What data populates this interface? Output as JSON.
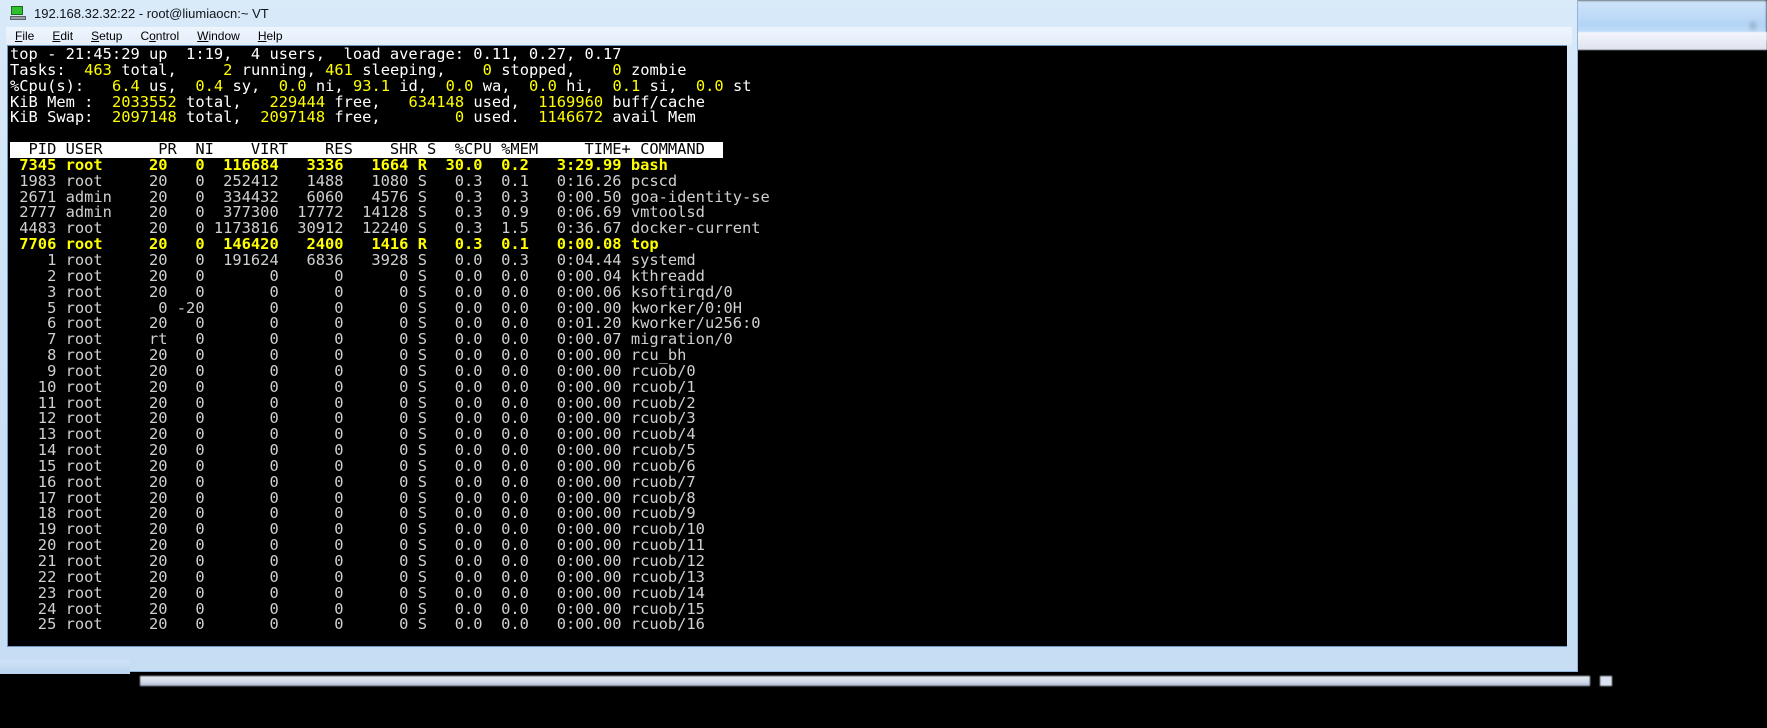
{
  "window": {
    "title": "192.168.32.32:22 - root@liumiaocn:~ VT",
    "icon": "terminal-icon",
    "menu": [
      "File",
      "Edit",
      "Setup",
      "Control",
      "Window",
      "Help"
    ]
  },
  "terminal": {
    "summary": {
      "line1": "top - 21:45:29 up  1:19,  4 users,  load average: 0.11, 0.27, 0.17",
      "tasks_label": "Tasks:",
      "tasks": {
        "total": "463",
        "total_label": "total,",
        "running": "2",
        "running_label": "running,",
        "sleeping": "461",
        "sleeping_label": "sleeping,",
        "stopped": "0",
        "stopped_label": "stopped,",
        "zombie": "0",
        "zombie_label": "zombie"
      },
      "cpu_label": "%Cpu(s):",
      "cpu": {
        "us": "6.4",
        "us_label": "us,",
        "sy": "0.4",
        "sy_label": "sy,",
        "ni": "0.0",
        "ni_label": "ni,",
        "id": "93.1",
        "id_label": "id,",
        "wa": "0.0",
        "wa_label": "wa,",
        "hi": "0.0",
        "hi_label": "hi,",
        "si": "0.1",
        "si_label": "si,",
        "st": "0.0",
        "st_label": "st"
      },
      "mem_label": "KiB Mem :",
      "mem": {
        "total": "2033552",
        "total_label": "total,",
        "free": "229444",
        "free_label": "free,",
        "used": "634148",
        "used_label": "used,",
        "buff": "1169960",
        "buff_label": "buff/cache"
      },
      "swap_label": "KiB Swap:",
      "swap": {
        "total": "2097148",
        "total_label": "total,",
        "free": "2097148",
        "free_label": "free,",
        "used": "0",
        "used_label": "used.",
        "avail": "1146672",
        "avail_label": "avail Mem"
      }
    },
    "columns_line": "  PID USER      PR  NI    VIRT    RES    SHR S  %CPU %MEM     TIME+ COMMAND",
    "columns": [
      "PID",
      "USER",
      "PR",
      "NI",
      "VIRT",
      "RES",
      "SHR",
      "S",
      "%CPU",
      "%MEM",
      "TIME+",
      "COMMAND"
    ],
    "rows": [
      {
        "pid": "7345",
        "user": "root",
        "pr": "20",
        "ni": "0",
        "virt": "116684",
        "res": "3336",
        "shr": "1664",
        "s": "R",
        "cpu": "30.0",
        "mem": "0.2",
        "time": "3:29.99",
        "command": "bash",
        "highlight": true
      },
      {
        "pid": "1983",
        "user": "root",
        "pr": "20",
        "ni": "0",
        "virt": "252412",
        "res": "1488",
        "shr": "1080",
        "s": "S",
        "cpu": "0.3",
        "mem": "0.1",
        "time": "0:16.26",
        "command": "pcscd",
        "highlight": false
      },
      {
        "pid": "2671",
        "user": "admin",
        "pr": "20",
        "ni": "0",
        "virt": "334432",
        "res": "6060",
        "shr": "4576",
        "s": "S",
        "cpu": "0.3",
        "mem": "0.3",
        "time": "0:00.50",
        "command": "goa-identity-se",
        "highlight": false
      },
      {
        "pid": "2777",
        "user": "admin",
        "pr": "20",
        "ni": "0",
        "virt": "377300",
        "res": "17772",
        "shr": "14128",
        "s": "S",
        "cpu": "0.3",
        "mem": "0.9",
        "time": "0:06.69",
        "command": "vmtoolsd",
        "highlight": false
      },
      {
        "pid": "4483",
        "user": "root",
        "pr": "20",
        "ni": "0",
        "virt": "1173816",
        "res": "30912",
        "shr": "12240",
        "s": "S",
        "cpu": "0.3",
        "mem": "1.5",
        "time": "0:36.67",
        "command": "docker-current",
        "highlight": false
      },
      {
        "pid": "7706",
        "user": "root",
        "pr": "20",
        "ni": "0",
        "virt": "146420",
        "res": "2400",
        "shr": "1416",
        "s": "R",
        "cpu": "0.3",
        "mem": "0.1",
        "time": "0:00.08",
        "command": "top",
        "highlight": true
      },
      {
        "pid": "1",
        "user": "root",
        "pr": "20",
        "ni": "0",
        "virt": "191624",
        "res": "6836",
        "shr": "3928",
        "s": "S",
        "cpu": "0.0",
        "mem": "0.3",
        "time": "0:04.44",
        "command": "systemd",
        "highlight": false
      },
      {
        "pid": "2",
        "user": "root",
        "pr": "20",
        "ni": "0",
        "virt": "0",
        "res": "0",
        "shr": "0",
        "s": "S",
        "cpu": "0.0",
        "mem": "0.0",
        "time": "0:00.04",
        "command": "kthreadd",
        "highlight": false
      },
      {
        "pid": "3",
        "user": "root",
        "pr": "20",
        "ni": "0",
        "virt": "0",
        "res": "0",
        "shr": "0",
        "s": "S",
        "cpu": "0.0",
        "mem": "0.0",
        "time": "0:00.06",
        "command": "ksoftirqd/0",
        "highlight": false
      },
      {
        "pid": "5",
        "user": "root",
        "pr": "0",
        "ni": "-20",
        "virt": "0",
        "res": "0",
        "shr": "0",
        "s": "S",
        "cpu": "0.0",
        "mem": "0.0",
        "time": "0:00.00",
        "command": "kworker/0:0H",
        "highlight": false
      },
      {
        "pid": "6",
        "user": "root",
        "pr": "20",
        "ni": "0",
        "virt": "0",
        "res": "0",
        "shr": "0",
        "s": "S",
        "cpu": "0.0",
        "mem": "0.0",
        "time": "0:01.20",
        "command": "kworker/u256:0",
        "highlight": false
      },
      {
        "pid": "7",
        "user": "root",
        "pr": "rt",
        "ni": "0",
        "virt": "0",
        "res": "0",
        "shr": "0",
        "s": "S",
        "cpu": "0.0",
        "mem": "0.0",
        "time": "0:00.07",
        "command": "migration/0",
        "highlight": false
      },
      {
        "pid": "8",
        "user": "root",
        "pr": "20",
        "ni": "0",
        "virt": "0",
        "res": "0",
        "shr": "0",
        "s": "S",
        "cpu": "0.0",
        "mem": "0.0",
        "time": "0:00.00",
        "command": "rcu_bh",
        "highlight": false
      },
      {
        "pid": "9",
        "user": "root",
        "pr": "20",
        "ni": "0",
        "virt": "0",
        "res": "0",
        "shr": "0",
        "s": "S",
        "cpu": "0.0",
        "mem": "0.0",
        "time": "0:00.00",
        "command": "rcuob/0",
        "highlight": false
      },
      {
        "pid": "10",
        "user": "root",
        "pr": "20",
        "ni": "0",
        "virt": "0",
        "res": "0",
        "shr": "0",
        "s": "S",
        "cpu": "0.0",
        "mem": "0.0",
        "time": "0:00.00",
        "command": "rcuob/1",
        "highlight": false
      },
      {
        "pid": "11",
        "user": "root",
        "pr": "20",
        "ni": "0",
        "virt": "0",
        "res": "0",
        "shr": "0",
        "s": "S",
        "cpu": "0.0",
        "mem": "0.0",
        "time": "0:00.00",
        "command": "rcuob/2",
        "highlight": false
      },
      {
        "pid": "12",
        "user": "root",
        "pr": "20",
        "ni": "0",
        "virt": "0",
        "res": "0",
        "shr": "0",
        "s": "S",
        "cpu": "0.0",
        "mem": "0.0",
        "time": "0:00.00",
        "command": "rcuob/3",
        "highlight": false
      },
      {
        "pid": "13",
        "user": "root",
        "pr": "20",
        "ni": "0",
        "virt": "0",
        "res": "0",
        "shr": "0",
        "s": "S",
        "cpu": "0.0",
        "mem": "0.0",
        "time": "0:00.00",
        "command": "rcuob/4",
        "highlight": false
      },
      {
        "pid": "14",
        "user": "root",
        "pr": "20",
        "ni": "0",
        "virt": "0",
        "res": "0",
        "shr": "0",
        "s": "S",
        "cpu": "0.0",
        "mem": "0.0",
        "time": "0:00.00",
        "command": "rcuob/5",
        "highlight": false
      },
      {
        "pid": "15",
        "user": "root",
        "pr": "20",
        "ni": "0",
        "virt": "0",
        "res": "0",
        "shr": "0",
        "s": "S",
        "cpu": "0.0",
        "mem": "0.0",
        "time": "0:00.00",
        "command": "rcuob/6",
        "highlight": false
      },
      {
        "pid": "16",
        "user": "root",
        "pr": "20",
        "ni": "0",
        "virt": "0",
        "res": "0",
        "shr": "0",
        "s": "S",
        "cpu": "0.0",
        "mem": "0.0",
        "time": "0:00.00",
        "command": "rcuob/7",
        "highlight": false
      },
      {
        "pid": "17",
        "user": "root",
        "pr": "20",
        "ni": "0",
        "virt": "0",
        "res": "0",
        "shr": "0",
        "s": "S",
        "cpu": "0.0",
        "mem": "0.0",
        "time": "0:00.00",
        "command": "rcuob/8",
        "highlight": false
      },
      {
        "pid": "18",
        "user": "root",
        "pr": "20",
        "ni": "0",
        "virt": "0",
        "res": "0",
        "shr": "0",
        "s": "S",
        "cpu": "0.0",
        "mem": "0.0",
        "time": "0:00.00",
        "command": "rcuob/9",
        "highlight": false
      },
      {
        "pid": "19",
        "user": "root",
        "pr": "20",
        "ni": "0",
        "virt": "0",
        "res": "0",
        "shr": "0",
        "s": "S",
        "cpu": "0.0",
        "mem": "0.0",
        "time": "0:00.00",
        "command": "rcuob/10",
        "highlight": false
      },
      {
        "pid": "20",
        "user": "root",
        "pr": "20",
        "ni": "0",
        "virt": "0",
        "res": "0",
        "shr": "0",
        "s": "S",
        "cpu": "0.0",
        "mem": "0.0",
        "time": "0:00.00",
        "command": "rcuob/11",
        "highlight": false
      },
      {
        "pid": "21",
        "user": "root",
        "pr": "20",
        "ni": "0",
        "virt": "0",
        "res": "0",
        "shr": "0",
        "s": "S",
        "cpu": "0.0",
        "mem": "0.0",
        "time": "0:00.00",
        "command": "rcuob/12",
        "highlight": false
      },
      {
        "pid": "22",
        "user": "root",
        "pr": "20",
        "ni": "0",
        "virt": "0",
        "res": "0",
        "shr": "0",
        "s": "S",
        "cpu": "0.0",
        "mem": "0.0",
        "time": "0:00.00",
        "command": "rcuob/13",
        "highlight": false
      },
      {
        "pid": "23",
        "user": "root",
        "pr": "20",
        "ni": "0",
        "virt": "0",
        "res": "0",
        "shr": "0",
        "s": "S",
        "cpu": "0.0",
        "mem": "0.0",
        "time": "0:00.00",
        "command": "rcuob/14",
        "highlight": false
      },
      {
        "pid": "24",
        "user": "root",
        "pr": "20",
        "ni": "0",
        "virt": "0",
        "res": "0",
        "shr": "0",
        "s": "S",
        "cpu": "0.0",
        "mem": "0.0",
        "time": "0:00.00",
        "command": "rcuob/15",
        "highlight": false
      },
      {
        "pid": "25",
        "user": "root",
        "pr": "20",
        "ni": "0",
        "virt": "0",
        "res": "0",
        "shr": "0",
        "s": "S",
        "cpu": "0.0",
        "mem": "0.0",
        "time": "0:00.00",
        "command": "rcuob/16",
        "highlight": false
      }
    ]
  },
  "colors": {
    "terminal_bg": "#000000",
    "terminal_fg": "#d8d8d8",
    "highlight": "#ffff00",
    "header_bg": "#ffffff",
    "header_fg": "#000000",
    "window_chrome": "#cfe3f7"
  }
}
